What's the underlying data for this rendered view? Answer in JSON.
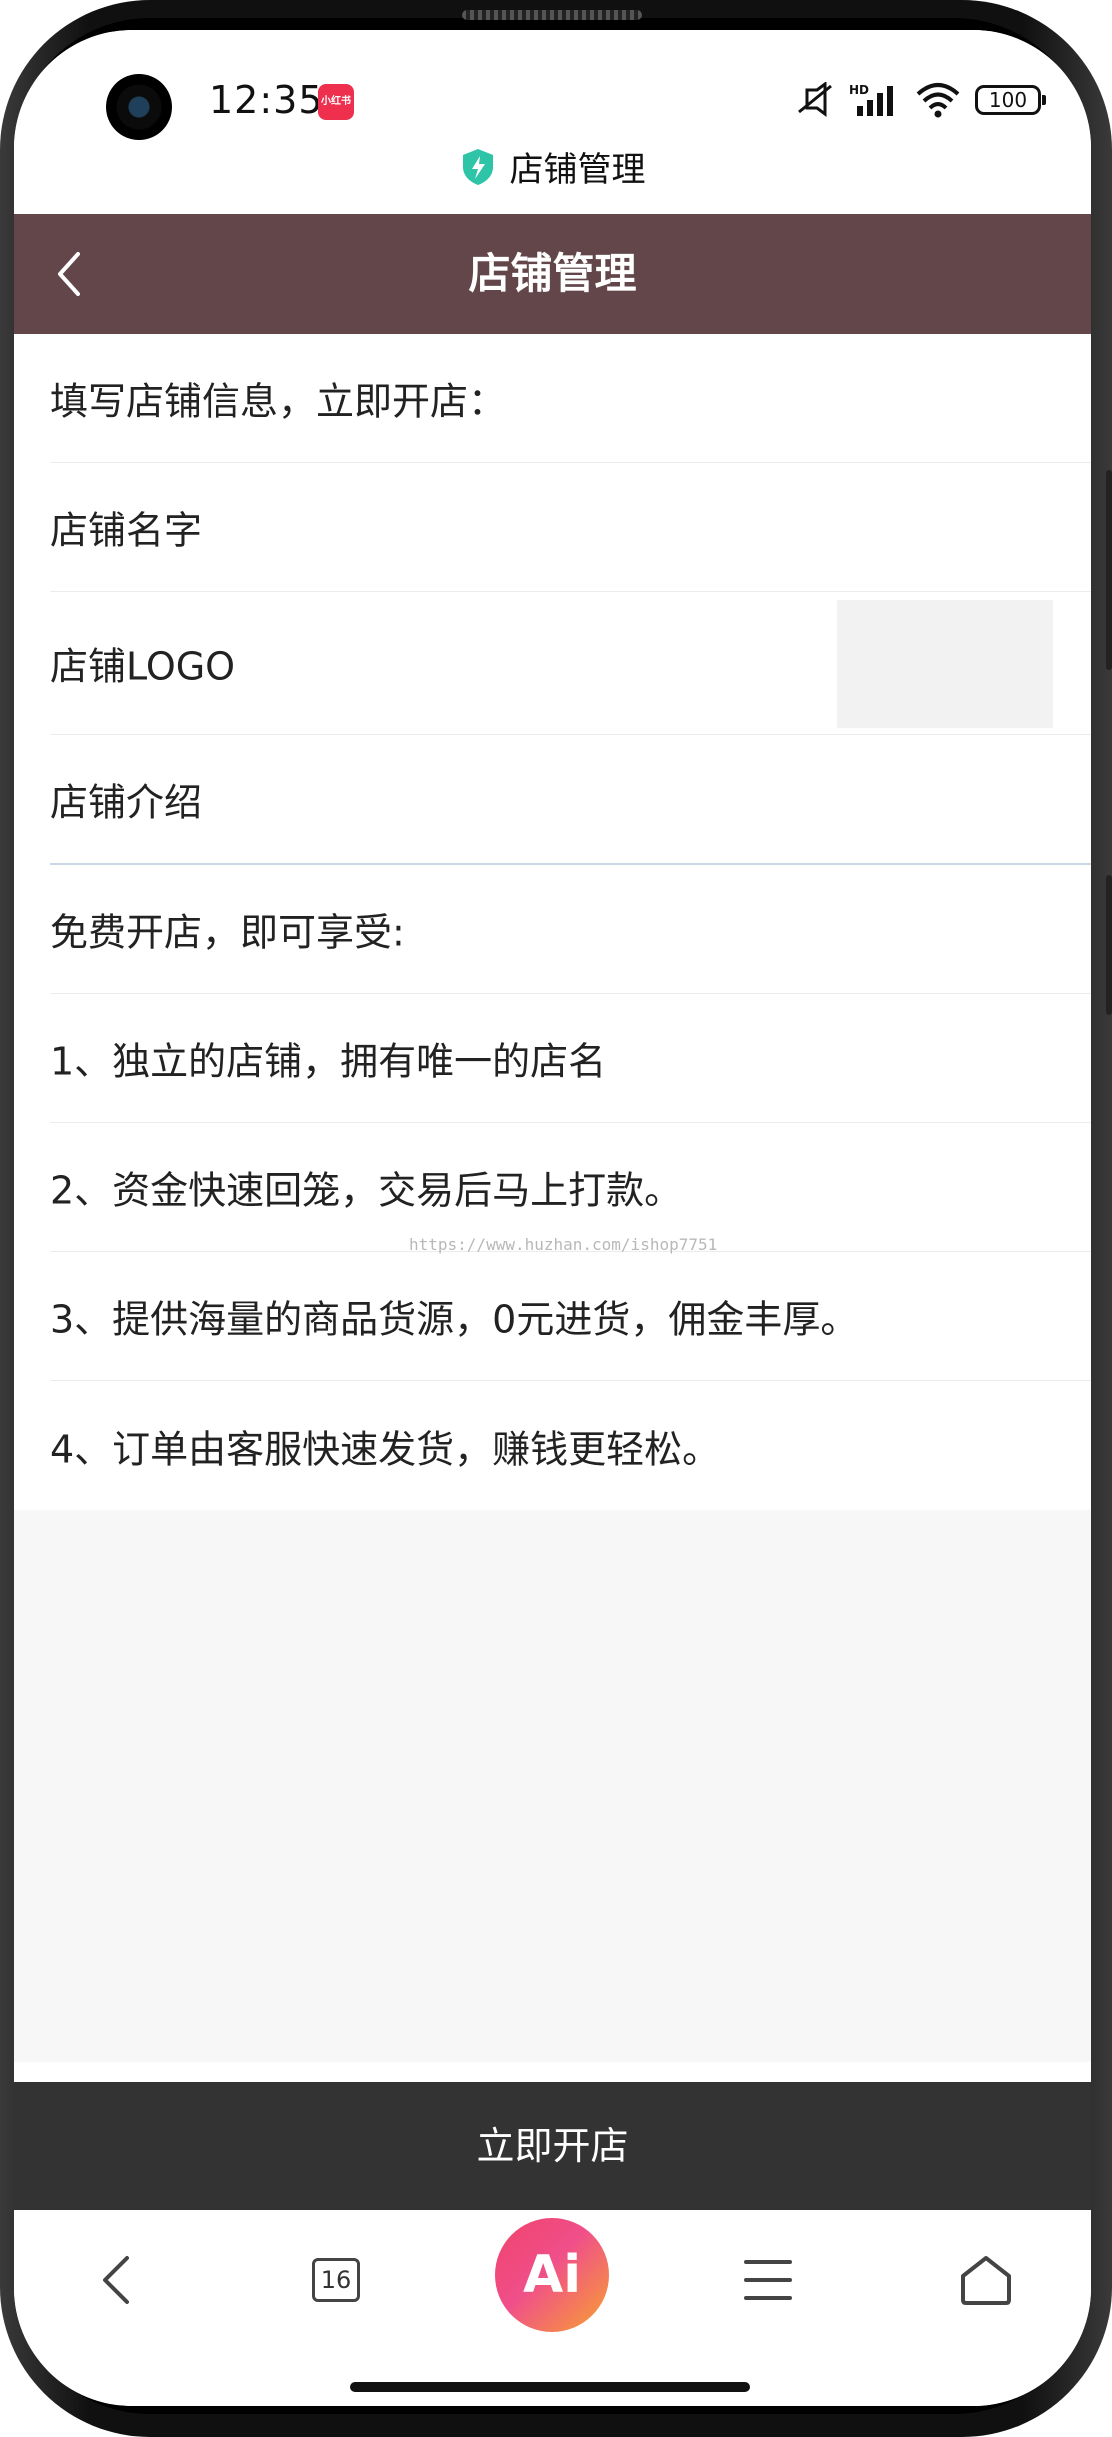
{
  "status_bar": {
    "time": "12:35",
    "app_badge_text": "小红书",
    "battery_level": "100",
    "icons": [
      "mute-icon",
      "hd-signal-icon",
      "wifi-icon",
      "battery-icon"
    ]
  },
  "page_label": {
    "text": "店铺管理",
    "icon": "shield-icon"
  },
  "header": {
    "title": "店铺管理",
    "back_icon": "chevron-left-icon",
    "color": "#62464a"
  },
  "form": {
    "intro": "填写店铺信息，立即开店：",
    "shop_name_label": "店铺名字",
    "shop_logo_label": "店铺LOGO",
    "shop_desc_label": "店铺介绍"
  },
  "benefits": {
    "heading": "免费开店，即可享受:",
    "items": [
      "1、独立的店铺，拥有唯一的店名",
      "2、资金快速回笼，交易后马上打款。",
      "3、提供海量的商品货源，0元进货，佣金丰厚。",
      "4、订单由客服快速发货，赚钱更轻松。"
    ]
  },
  "watermark": "https://www.huzhan.com/ishop7751",
  "open_shop_button": "立即开店",
  "bottom_nav": {
    "tab_count": "16",
    "ai_label": "Ai",
    "icons": [
      "back-icon",
      "tabs-icon",
      "ai-icon",
      "menu-icon",
      "home-icon"
    ]
  }
}
